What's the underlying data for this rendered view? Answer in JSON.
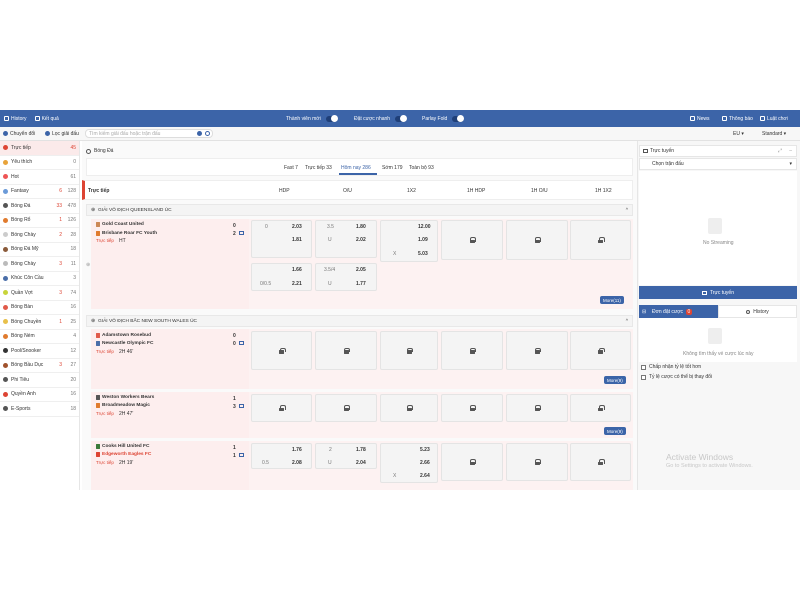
{
  "topbar": {
    "history": "History",
    "results": "Kết quả",
    "new_member": "Thành viên mới",
    "quick_bet": "Đặt cược nhanh",
    "parlay_fold": "Parlay Fold",
    "news": "News",
    "notifications": "Thông báo",
    "rules": "Luật chơi"
  },
  "subbar": {
    "switch": "Chuyển đổi",
    "filter": "Lọc giải đấu",
    "search_placeholder": "Tìm kiếm giải đấu hoặc trận đấu",
    "currency": "EU",
    "view": "Standard"
  },
  "sidebar": {
    "items": [
      {
        "label": "Trực tiếp",
        "red": "",
        "count": "45",
        "color": "#d43"
      },
      {
        "label": "Yêu thích",
        "red": "",
        "count": "0",
        "color": "#e8a33a"
      },
      {
        "label": "Hot",
        "red": "",
        "count": "61",
        "color": "#e55"
      },
      {
        "label": "Fantasy",
        "red": "6",
        "count": "128",
        "color": "#6b9ad8"
      },
      {
        "label": "Bóng Đá",
        "red": "33",
        "count": "478",
        "color": "#555"
      },
      {
        "label": "Bóng Rổ",
        "red": "1",
        "count": "126",
        "color": "#e07b2e"
      },
      {
        "label": "Bóng Chày",
        "red": "2",
        "count": "28",
        "color": "#ccc"
      },
      {
        "label": "Bóng Đá Mỹ",
        "red": "",
        "count": "18",
        "color": "#8a5a3a"
      },
      {
        "label": "Bóng Chày",
        "red": "3",
        "count": "11",
        "color": "#bbb"
      },
      {
        "label": "Khúc Côn Cầu",
        "red": "",
        "count": "3",
        "color": "#4a6ea8"
      },
      {
        "label": "Quần Vợt",
        "red": "3",
        "count": "74",
        "color": "#c8d43a"
      },
      {
        "label": "Bóng Bàn",
        "red": "",
        "count": "16",
        "color": "#e05a4a"
      },
      {
        "label": "Bóng Chuyền",
        "red": "1",
        "count": "25",
        "color": "#e8c04a"
      },
      {
        "label": "Bóng Ném",
        "red": "",
        "count": "4",
        "color": "#e07b2e"
      },
      {
        "label": "Pool/Snooker",
        "red": "",
        "count": "12",
        "color": "#333"
      },
      {
        "label": "Bóng Bầu Dục",
        "red": "3",
        "count": "27",
        "color": "#a0522d"
      },
      {
        "label": "Phi Tiêu",
        "red": "",
        "count": "20",
        "color": "#555"
      },
      {
        "label": "Quyền Anh",
        "red": "",
        "count": "16",
        "color": "#d43"
      },
      {
        "label": "E-Sports",
        "red": "",
        "count": "18",
        "color": "#555"
      }
    ]
  },
  "main": {
    "sport_title": "Bóng Đá",
    "tabs": [
      "Fast 7",
      "Trực tiếp 33",
      "Hôm nay 286",
      "Sớm 179",
      "Toàn bộ 93"
    ],
    "columns": [
      "Trực tiếp",
      "HDP",
      "O/U",
      "1X2",
      "1H HDP",
      "1H O/U",
      "1H 1X2"
    ],
    "league1": "GIẢI VÔ ĐỊCH QUEENSLAND ÚC",
    "league2": "GIẢI VÔ ĐỊCH BẮC NEW SOUTH WALES ÚC",
    "m1": {
      "home": "Gold Coast United",
      "away": "Brisbane Roar FC Youth",
      "hs": "0",
      "as": "2",
      "status": "Trực tiếp",
      "time": "HT",
      "r1": {
        "hdp": "0",
        "hdp_o1": "2.03",
        "ou": "3.5",
        "ou_o1": "1.80",
        "x1": "12.00"
      },
      "r2": {
        "hdp_o2": "1.81",
        "u": "U",
        "ou_o2": "2.02",
        "x2": "1.09"
      },
      "r3": {
        "x": "X",
        "xv": "5.03"
      },
      "r4": {
        "hdp_o1": "1.66",
        "ou": "3.5/4",
        "ou_o1": "2.05"
      },
      "r5": {
        "hdp": "0/0.5",
        "hdp_o2": "2.21",
        "u": "U",
        "ou_o2": "1.77"
      },
      "more": "More(11)"
    },
    "m2": {
      "home": "Adamstown Rosebud",
      "away": "Newcastle Olympic FC",
      "hs": "0",
      "as": "0",
      "status": "Trực tiếp",
      "time": "2H 46'",
      "more": "More(9)"
    },
    "m3": {
      "home": "Weston Workers Bears",
      "away": "Broadmeadow Magic",
      "hs": "1",
      "as": "3",
      "status": "Trực tiếp",
      "time": "2H 47'",
      "more": "More(9)"
    },
    "m4": {
      "home": "Cooks Hill United FC",
      "away": "Edgeworth Eagles FC",
      "hs": "1",
      "as": "1",
      "status": "Trực tiếp",
      "time": "2H 19'",
      "r1": {
        "hdp_o1": "1.76",
        "ou": "2",
        "ou_o1": "1.78",
        "x1": "5.23"
      },
      "r2": {
        "hdp": "0.5",
        "hdp_o2": "2.08",
        "u": "U",
        "ou_o2": "2.04",
        "x2": "2.66"
      },
      "r3": {
        "x": "X",
        "xv": "2.64"
      }
    }
  },
  "right": {
    "live_title": "Trực tuyến",
    "select_match": "Chọn trận đấu",
    "no_streaming": "No Streaming",
    "live_button": "Trực tuyến",
    "tab_betslip": "Đơn đặt cược",
    "betslip_count": "0",
    "tab_history": "History",
    "empty_text": "Không tìm thấy vé cược lúc này",
    "opt1": "Chấp nhận tỷ lệ tốt hơn",
    "opt2": "Tỷ lệ cược có thể bị thay đổi"
  },
  "watermark": {
    "title": "Activate Windows",
    "sub": "Go to Settings to activate Windows."
  }
}
